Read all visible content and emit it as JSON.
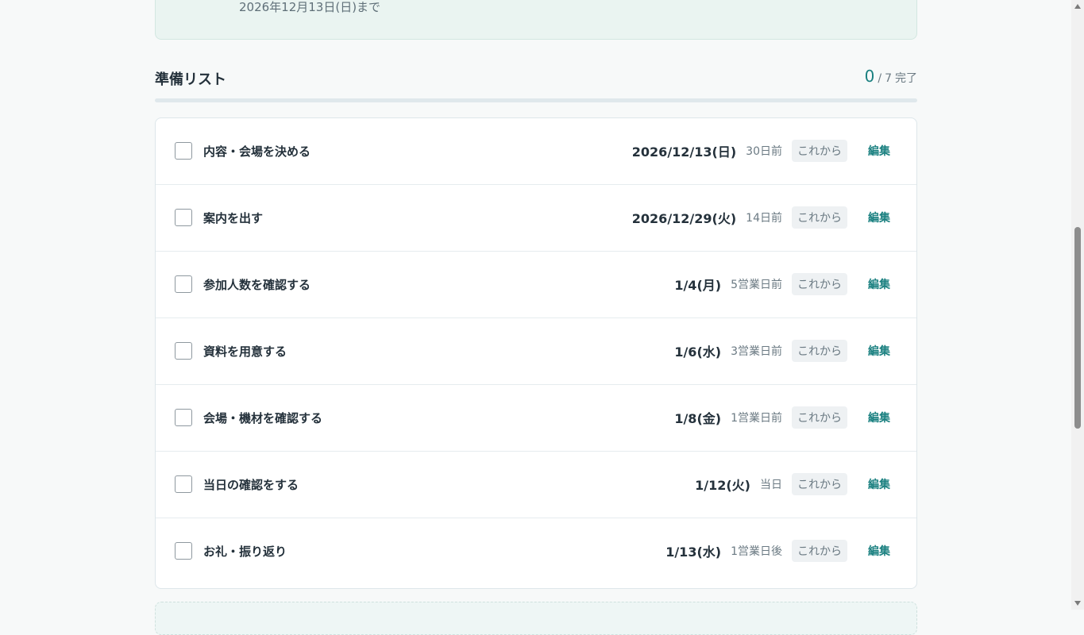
{
  "info": {
    "date_text": "2026年12月13日(日)まで"
  },
  "list": {
    "title": "準備リスト",
    "completed_count": "0",
    "separator": "/",
    "total_count": "7",
    "suffix": "完了",
    "completion_fraction": 0
  },
  "tasks": [
    {
      "title": "内容・会場を決める",
      "date": "2026/12/13(日)",
      "relative": "30日前",
      "status": "これから",
      "edit_label": "編集"
    },
    {
      "title": "案内を出す",
      "date": "2026/12/29(火)",
      "relative": "14日前",
      "status": "これから",
      "edit_label": "編集"
    },
    {
      "title": "参加人数を確認する",
      "date": "1/4(月)",
      "relative": "5営業日前",
      "status": "これから",
      "edit_label": "編集"
    },
    {
      "title": "資料を用意する",
      "date": "1/6(水)",
      "relative": "3営業日前",
      "status": "これから",
      "edit_label": "編集"
    },
    {
      "title": "会場・機材を確認する",
      "date": "1/8(金)",
      "relative": "1営業日前",
      "status": "これから",
      "edit_label": "編集"
    },
    {
      "title": "当日の確認をする",
      "date": "1/12(火)",
      "relative": "当日",
      "status": "これから",
      "edit_label": "編集"
    },
    {
      "title": "お礼・振り返り",
      "date": "1/13(水)",
      "relative": "1営業日後",
      "status": "これから",
      "edit_label": "編集"
    }
  ]
}
